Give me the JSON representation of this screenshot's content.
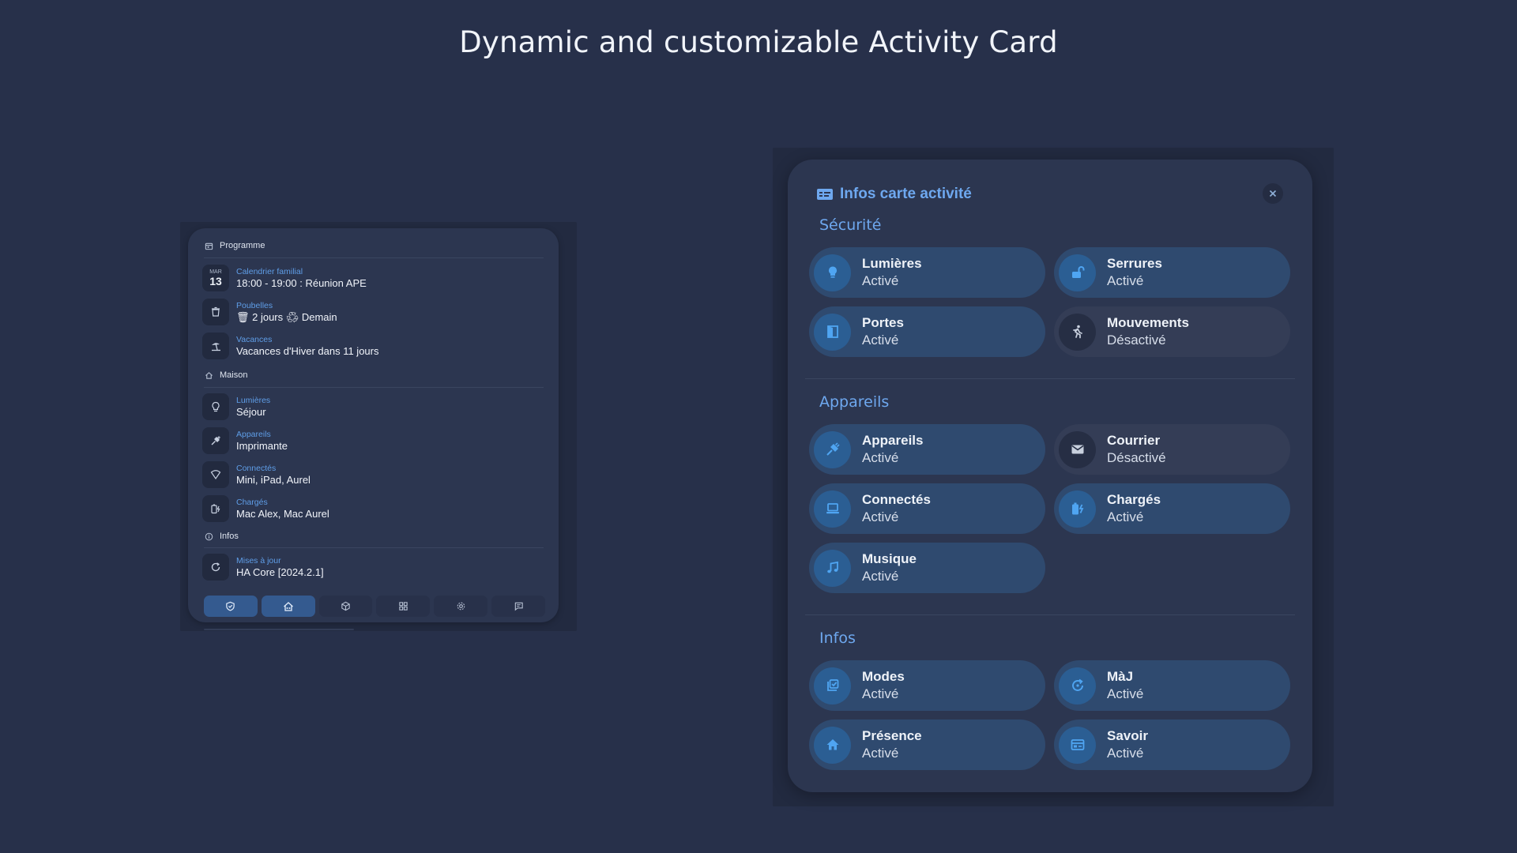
{
  "page": {
    "title": "Dynamic and customizable Activity Card"
  },
  "activity_card": {
    "sections": {
      "programme": "Programme",
      "maison": "Maison",
      "infos": "Infos"
    },
    "date": {
      "dow": "MAR",
      "dom": "13"
    },
    "rows": [
      {
        "label": "Calendrier familial",
        "value": "18:00 - 19:00 : Réunion APE"
      },
      {
        "label": "Poubelles",
        "value": "🗑 2 jours ♻ Demain"
      },
      {
        "label": "Vacances",
        "value": "Vacances d'Hiver dans 11 jours"
      },
      {
        "label": "Lumières",
        "value": "Séjour"
      },
      {
        "label": "Appareils",
        "value": "Imprimante"
      },
      {
        "label": "Connectés",
        "value": "Mini, iPad, Aurel"
      },
      {
        "label": "Chargés",
        "value": "Mac Alex, Mac Aurel"
      },
      {
        "label": "Mises à jour",
        "value": "HA Core [2024.2.1]"
      }
    ],
    "nav_icons": [
      "shield-icon",
      "home-icon",
      "cube-icon",
      "grid-icon",
      "gear-icon",
      "chat-icon"
    ],
    "active_nav": [
      0,
      1
    ]
  },
  "popup": {
    "title": "Infos carte activité",
    "groups": [
      {
        "title": "Sécurité"
      },
      {
        "title": "Appareils"
      },
      {
        "title": "Infos"
      }
    ],
    "chips": [
      {
        "name": "Lumières",
        "state": "Activé",
        "on": true,
        "icon": "bulb-icon"
      },
      {
        "name": "Serrures",
        "state": "Activé",
        "on": true,
        "icon": "lock-open-icon"
      },
      {
        "name": "Portes",
        "state": "Activé",
        "on": true,
        "icon": "door-icon"
      },
      {
        "name": "Mouvements",
        "state": "Désactivé",
        "on": false,
        "icon": "walk-icon"
      },
      {
        "name": "Appareils",
        "state": "Activé",
        "on": true,
        "icon": "plug-icon"
      },
      {
        "name": "Courrier",
        "state": "Désactivé",
        "on": false,
        "icon": "mail-icon"
      },
      {
        "name": "Connectés",
        "state": "Activé",
        "on": true,
        "icon": "laptop-icon"
      },
      {
        "name": "Chargés",
        "state": "Activé",
        "on": true,
        "icon": "battery-charging-icon"
      },
      {
        "name": "Musique",
        "state": "Activé",
        "on": true,
        "icon": "music-icon"
      },
      {
        "name": "Modes",
        "state": "Activé",
        "on": true,
        "icon": "checklist-icon"
      },
      {
        "name": "MàJ",
        "state": "Activé",
        "on": true,
        "icon": "refresh-icon"
      },
      {
        "name": "Présence",
        "state": "Activé",
        "on": true,
        "icon": "home-icon"
      },
      {
        "name": "Savoir",
        "state": "Activé",
        "on": true,
        "icon": "card-icon"
      }
    ]
  },
  "colors": {
    "background": "#27304a",
    "card": "#2c3650",
    "accent": "#6ea8ef",
    "chip_on": "#2f4a6f",
    "chip_off": "#343d56"
  }
}
